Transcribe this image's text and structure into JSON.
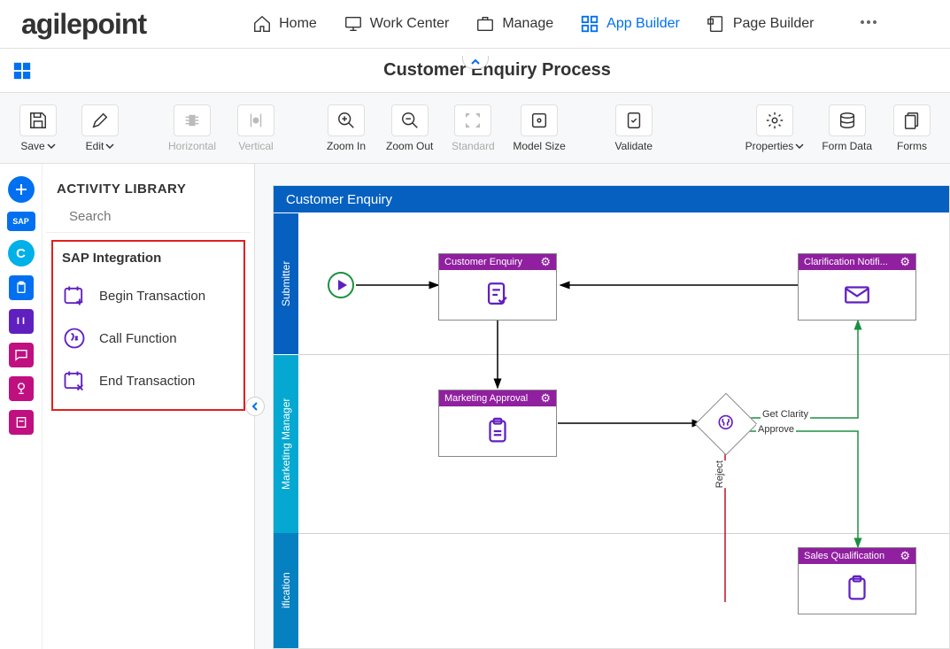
{
  "brand": "agilepoint",
  "nav": {
    "items": [
      {
        "id": "home",
        "label": "Home"
      },
      {
        "id": "work-center",
        "label": "Work Center"
      },
      {
        "id": "manage",
        "label": "Manage"
      },
      {
        "id": "app-builder",
        "label": "App Builder",
        "active": true
      },
      {
        "id": "page-builder",
        "label": "Page Builder"
      }
    ]
  },
  "page": {
    "title": "Customer Enquiry Process"
  },
  "toolbar": {
    "save": "Save",
    "edit": "Edit",
    "horizontal": "Horizontal",
    "vertical": "Vertical",
    "zoom_in": "Zoom In",
    "zoom_out": "Zoom Out",
    "standard": "Standard",
    "model_size": "Model Size",
    "validate": "Validate",
    "properties": "Properties",
    "form_data": "Form Data",
    "forms": "Forms"
  },
  "library": {
    "title": "ACTIVITY LIBRARY",
    "search_placeholder": "Search",
    "category": {
      "title": "SAP Integration"
    },
    "activities": [
      {
        "id": "begin-transaction",
        "label": "Begin Transaction"
      },
      {
        "id": "call-function",
        "label": "Call Function"
      },
      {
        "id": "end-transaction",
        "label": "End Transaction"
      }
    ]
  },
  "canvas": {
    "title": "Customer Enquiry",
    "lanes": [
      {
        "id": "submitter",
        "label": "Submitter"
      },
      {
        "id": "marketing-manager",
        "label": "Marketing Manager"
      },
      {
        "id": "qualification",
        "label": "ification"
      }
    ],
    "nodes": {
      "start": {
        "type": "start"
      },
      "customer_enquiry": {
        "type": "task",
        "label": "Customer Enquiry"
      },
      "clarification_notification": {
        "type": "task",
        "label": "Clarification Notifi..."
      },
      "marketing_approval": {
        "type": "task",
        "label": "Marketing Approval"
      },
      "gateway": {
        "type": "gateway"
      },
      "sales_qualification": {
        "type": "task",
        "label": "Sales Qualification"
      }
    },
    "edge_labels": {
      "get_clarity": "Get Clarity",
      "approve": "Approve",
      "reject": "Reject"
    }
  }
}
